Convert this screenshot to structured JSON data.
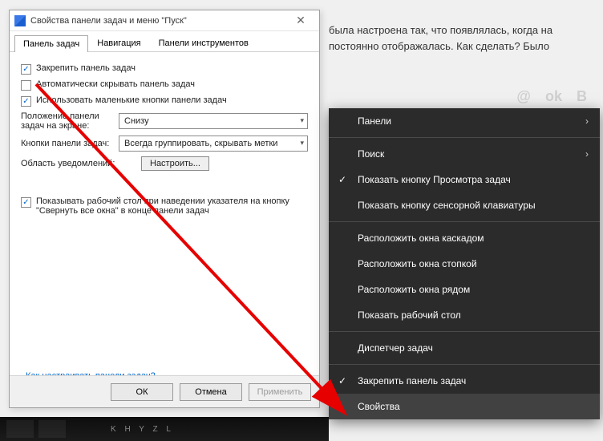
{
  "background": {
    "text_line1": "была настроена так, что появлялась, когда на",
    "text_line2": "постоянно отображалась. Как сделать? Было",
    "social": [
      "@",
      "ok",
      "В"
    ]
  },
  "dialog": {
    "title": "Свойства панели задач и меню \"Пуск\"",
    "tabs": [
      "Панель задач",
      "Навигация",
      "Панели инструментов"
    ],
    "active_tab": 0,
    "checks": {
      "pin": {
        "label": "Закрепить панель задач",
        "checked": true
      },
      "autohide": {
        "label": "Автоматически скрывать панель задач",
        "checked": false
      },
      "small_buttons": {
        "label": "Использовать маленькие кнопки панели задач",
        "checked": true
      }
    },
    "position_label": "Положение панели задач на экране:",
    "position_value": "Снизу",
    "buttons_label": "Кнопки панели задач:",
    "buttons_value": "Всегда группировать, скрывать метки",
    "notif_label": "Область уведомлений:",
    "notif_button": "Настроить...",
    "desktop_check": {
      "label": "Показывать рабочий стол при наведении указателя на кнопку \"Свернуть все окна\" в конце панели задач",
      "checked": true
    },
    "help_link": "Как настраивать панели задач?",
    "buttons": {
      "ok": "ОК",
      "cancel": "Отмена",
      "apply": "Применить"
    }
  },
  "context_menu": {
    "panels": "Панели",
    "search": "Поиск",
    "show_taskview": "Показать кнопку Просмотра задач",
    "show_touchkb": "Показать кнопку сенсорной клавиатуры",
    "cascade": "Расположить окна каскадом",
    "stack": "Расположить окна стопкой",
    "side": "Расположить окна рядом",
    "show_desktop": "Показать рабочий стол",
    "taskmgr": "Диспетчер задач",
    "lock": "Закрепить панель задач",
    "properties": "Свойства"
  },
  "taskbar_text": "K H Y Z L"
}
